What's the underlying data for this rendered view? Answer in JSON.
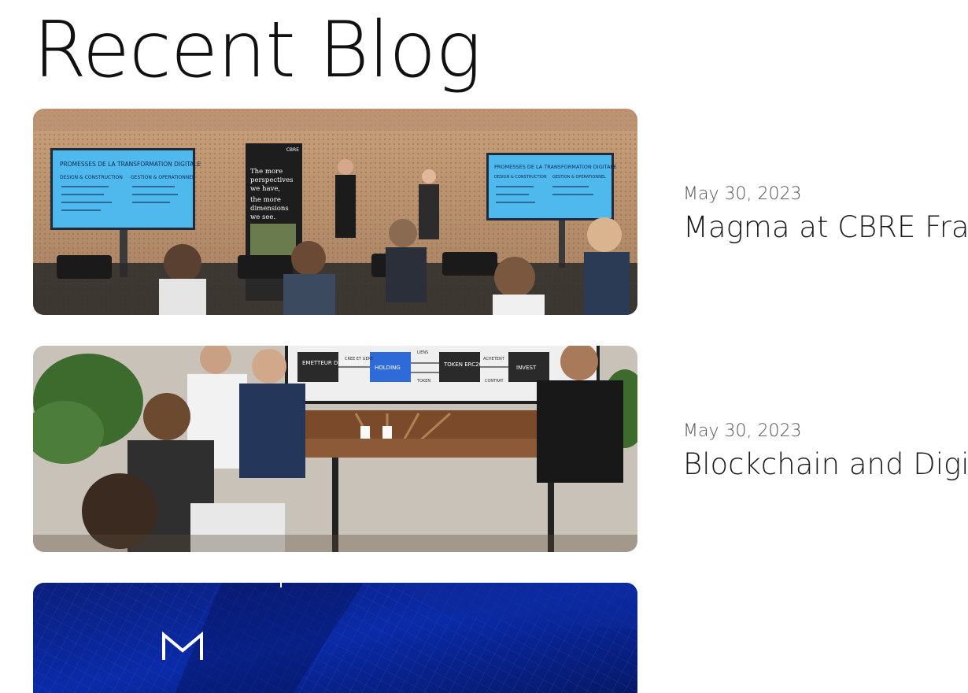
{
  "page": {
    "title": "Recent Blog"
  },
  "posts": [
    {
      "date": "May 30, 2023",
      "title": "Magma at CBRE France",
      "image_icon": "conference-photo",
      "image_text": {
        "screen_left_title": "PROMESSES DE LA TRANSFORMATION DIGITALE",
        "screen_left_col1": "DESIGN & CONSTRUCTION",
        "screen_left_col2": "GESTION & OPERATIONNEL",
        "banner_line1": "The more",
        "banner_line2": "perspectives",
        "banner_line3": "we have,",
        "banner_line4": "the more",
        "banner_line5": "dimensions",
        "banner_line6": "we see.",
        "banner_logo": "CBRE",
        "screen_right_title": "PROMESSES DE LA TRANSFORMATION DIGITALE",
        "screen_right_col1": "DESIGN & CONSTRUCTION",
        "screen_right_col2": "GESTION & OPERATIONNEL"
      }
    },
    {
      "date": "May 30, 2023",
      "title": "Blockchain and Digital Assets",
      "image_icon": "meeting-photo",
      "image_text": {
        "box1": "EMETTEUR DU TOKEN",
        "box2": "HOLDING",
        "box3": "TOKEN ERC20",
        "box4": "INVEST",
        "arrow1": "CREE ET GERE",
        "arrow2": "TOKEN",
        "arrow3": "ACHETENT",
        "arrow4": "LIENS",
        "arrow5": "CONTRAT"
      }
    },
    {
      "image_icon": "magma-logo-graphic"
    }
  ]
}
